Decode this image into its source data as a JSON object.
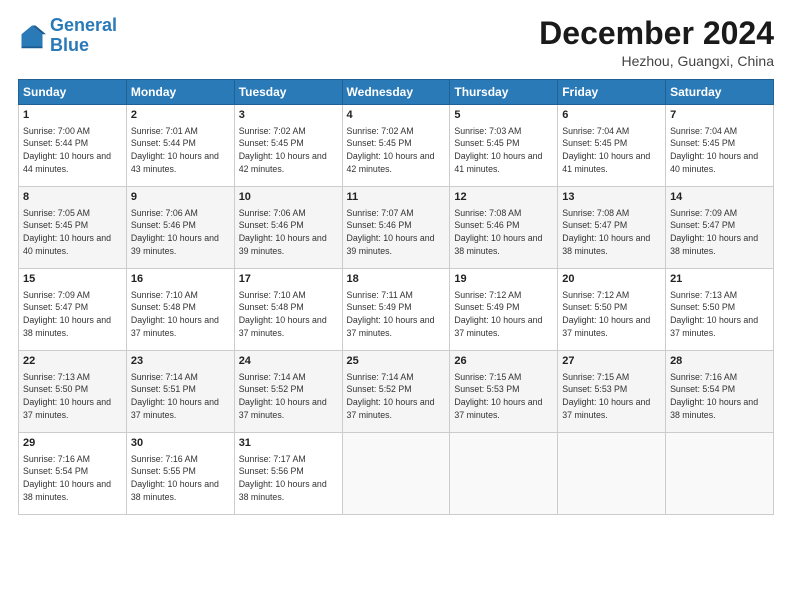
{
  "header": {
    "logo_line1": "General",
    "logo_line2": "Blue",
    "title": "December 2024",
    "subtitle": "Hezhou, Guangxi, China"
  },
  "calendar": {
    "days_of_week": [
      "Sunday",
      "Monday",
      "Tuesday",
      "Wednesday",
      "Thursday",
      "Friday",
      "Saturday"
    ],
    "weeks": [
      [
        null,
        null,
        {
          "day": 1,
          "sunrise": "7:00 AM",
          "sunset": "5:44 PM",
          "daylight": "10 hours and 44 minutes."
        },
        {
          "day": 2,
          "sunrise": "7:01 AM",
          "sunset": "5:44 PM",
          "daylight": "10 hours and 43 minutes."
        },
        {
          "day": 3,
          "sunrise": "7:02 AM",
          "sunset": "5:45 PM",
          "daylight": "10 hours and 42 minutes."
        },
        {
          "day": 4,
          "sunrise": "7:02 AM",
          "sunset": "5:45 PM",
          "daylight": "10 hours and 42 minutes."
        },
        {
          "day": 5,
          "sunrise": "7:03 AM",
          "sunset": "5:45 PM",
          "daylight": "10 hours and 41 minutes."
        },
        {
          "day": 6,
          "sunrise": "7:04 AM",
          "sunset": "5:45 PM",
          "daylight": "10 hours and 41 minutes."
        },
        {
          "day": 7,
          "sunrise": "7:04 AM",
          "sunset": "5:45 PM",
          "daylight": "10 hours and 40 minutes."
        }
      ],
      [
        {
          "day": 8,
          "sunrise": "7:05 AM",
          "sunset": "5:45 PM",
          "daylight": "10 hours and 40 minutes."
        },
        {
          "day": 9,
          "sunrise": "7:06 AM",
          "sunset": "5:46 PM",
          "daylight": "10 hours and 39 minutes."
        },
        {
          "day": 10,
          "sunrise": "7:06 AM",
          "sunset": "5:46 PM",
          "daylight": "10 hours and 39 minutes."
        },
        {
          "day": 11,
          "sunrise": "7:07 AM",
          "sunset": "5:46 PM",
          "daylight": "10 hours and 39 minutes."
        },
        {
          "day": 12,
          "sunrise": "7:08 AM",
          "sunset": "5:46 PM",
          "daylight": "10 hours and 38 minutes."
        },
        {
          "day": 13,
          "sunrise": "7:08 AM",
          "sunset": "5:47 PM",
          "daylight": "10 hours and 38 minutes."
        },
        {
          "day": 14,
          "sunrise": "7:09 AM",
          "sunset": "5:47 PM",
          "daylight": "10 hours and 38 minutes."
        }
      ],
      [
        {
          "day": 15,
          "sunrise": "7:09 AM",
          "sunset": "5:47 PM",
          "daylight": "10 hours and 38 minutes."
        },
        {
          "day": 16,
          "sunrise": "7:10 AM",
          "sunset": "5:48 PM",
          "daylight": "10 hours and 37 minutes."
        },
        {
          "day": 17,
          "sunrise": "7:10 AM",
          "sunset": "5:48 PM",
          "daylight": "10 hours and 37 minutes."
        },
        {
          "day": 18,
          "sunrise": "7:11 AM",
          "sunset": "5:49 PM",
          "daylight": "10 hours and 37 minutes."
        },
        {
          "day": 19,
          "sunrise": "7:12 AM",
          "sunset": "5:49 PM",
          "daylight": "10 hours and 37 minutes."
        },
        {
          "day": 20,
          "sunrise": "7:12 AM",
          "sunset": "5:50 PM",
          "daylight": "10 hours and 37 minutes."
        },
        {
          "day": 21,
          "sunrise": "7:13 AM",
          "sunset": "5:50 PM",
          "daylight": "10 hours and 37 minutes."
        }
      ],
      [
        {
          "day": 22,
          "sunrise": "7:13 AM",
          "sunset": "5:50 PM",
          "daylight": "10 hours and 37 minutes."
        },
        {
          "day": 23,
          "sunrise": "7:14 AM",
          "sunset": "5:51 PM",
          "daylight": "10 hours and 37 minutes."
        },
        {
          "day": 24,
          "sunrise": "7:14 AM",
          "sunset": "5:52 PM",
          "daylight": "10 hours and 37 minutes."
        },
        {
          "day": 25,
          "sunrise": "7:14 AM",
          "sunset": "5:52 PM",
          "daylight": "10 hours and 37 minutes."
        },
        {
          "day": 26,
          "sunrise": "7:15 AM",
          "sunset": "5:53 PM",
          "daylight": "10 hours and 37 minutes."
        },
        {
          "day": 27,
          "sunrise": "7:15 AM",
          "sunset": "5:53 PM",
          "daylight": "10 hours and 37 minutes."
        },
        {
          "day": 28,
          "sunrise": "7:16 AM",
          "sunset": "5:54 PM",
          "daylight": "10 hours and 38 minutes."
        }
      ],
      [
        {
          "day": 29,
          "sunrise": "7:16 AM",
          "sunset": "5:54 PM",
          "daylight": "10 hours and 38 minutes."
        },
        {
          "day": 30,
          "sunrise": "7:16 AM",
          "sunset": "5:55 PM",
          "daylight": "10 hours and 38 minutes."
        },
        {
          "day": 31,
          "sunrise": "7:17 AM",
          "sunset": "5:56 PM",
          "daylight": "10 hours and 38 minutes."
        },
        null,
        null,
        null,
        null
      ]
    ]
  }
}
